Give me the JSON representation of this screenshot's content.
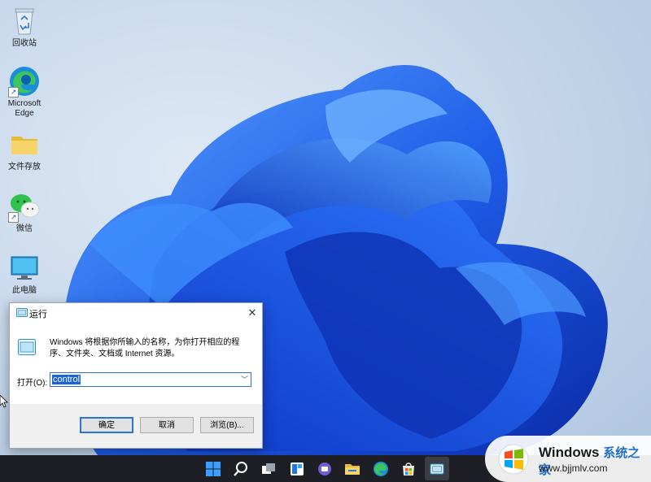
{
  "desktop": {
    "icons": [
      {
        "label": "回收站",
        "icon": "recycle-bin-icon"
      },
      {
        "label": "Microsoft Edge",
        "icon": "edge-icon"
      },
      {
        "label": "文件存放",
        "icon": "folder-icon"
      },
      {
        "label": "微信",
        "icon": "wechat-icon"
      },
      {
        "label": "此电脑",
        "icon": "monitor-icon"
      }
    ]
  },
  "run_dialog": {
    "title": "运行",
    "close_glyph": "✕",
    "description": "Windows 将根据你所输入的名称，为你打开相应的程序、文件夹、文档或 Internet 资源。",
    "open_label": "打开(O):",
    "open_value": "control",
    "ok_label": "确定",
    "cancel_label": "取消",
    "browse_label": "浏览(B)..."
  },
  "taskbar": {
    "icons": [
      "windows-start-icon",
      "search-icon",
      "task-view-icon",
      "widgets-icon",
      "teams-chat-icon",
      "file-explorer-icon",
      "edge-icon",
      "microsoft-store-icon",
      "run-icon"
    ]
  },
  "watermark": {
    "brand": "Windows",
    "brand_cn": "系统之家",
    "url": "www.bjjmlv.com"
  },
  "colors": {
    "accent": "#1c64d6",
    "taskbar": "#1d1f24",
    "bloom_dark": "#0b2fb8",
    "bloom_light": "#3d8cff"
  }
}
